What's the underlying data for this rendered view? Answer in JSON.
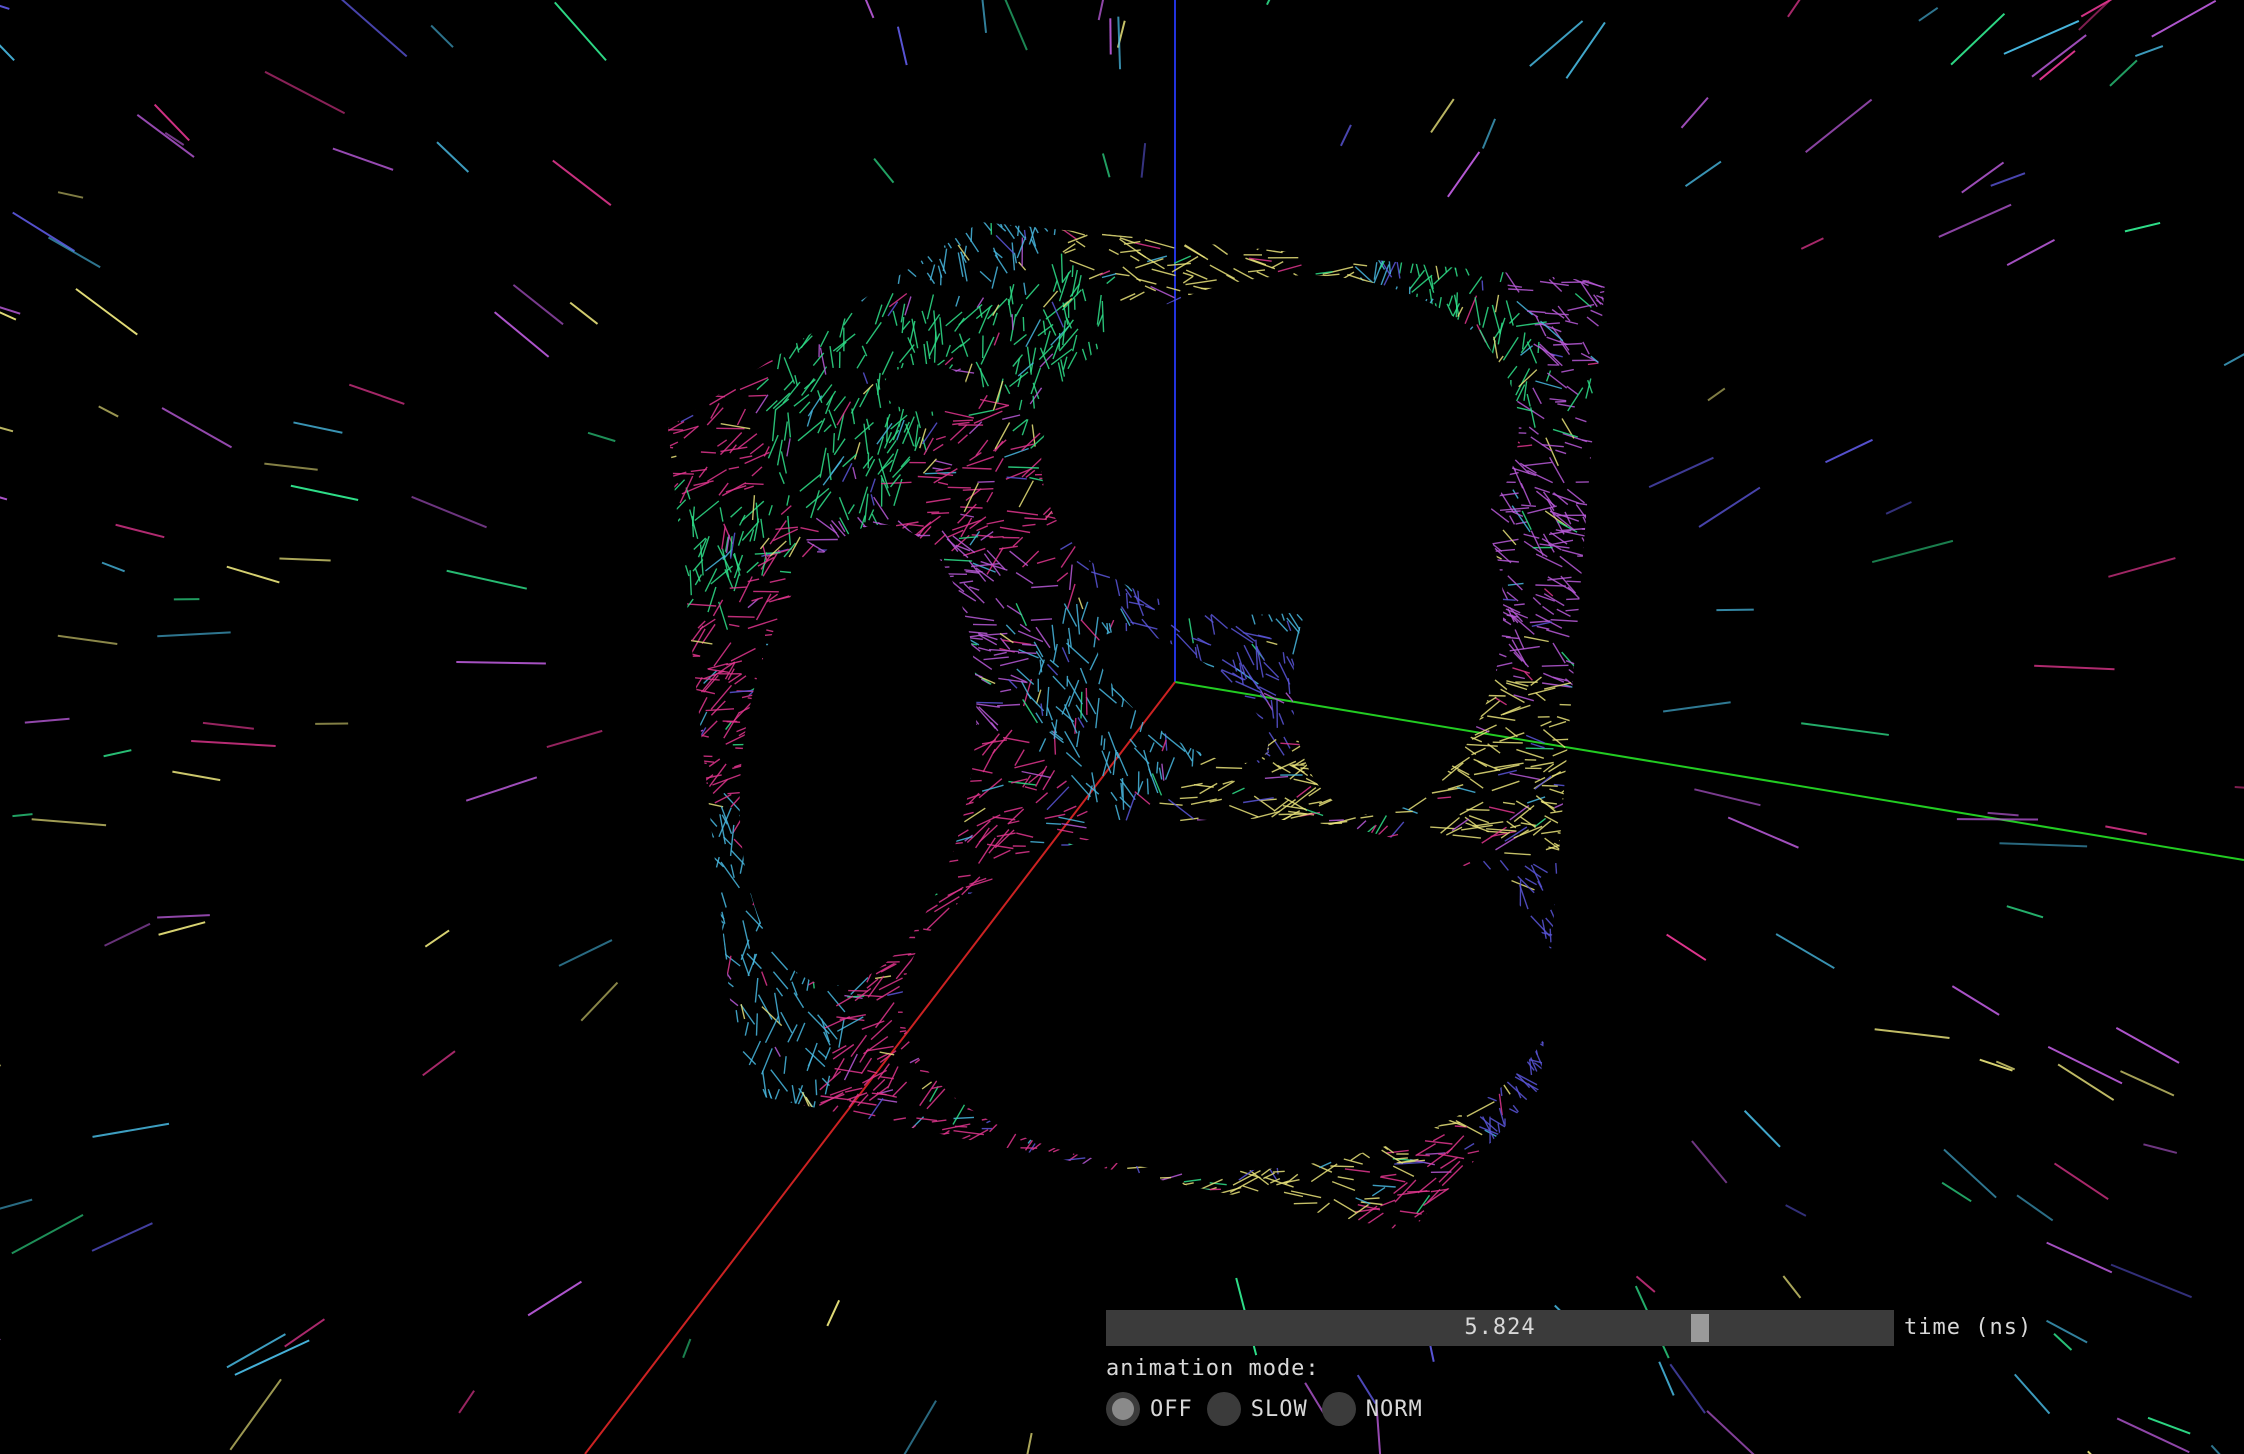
{
  "time_slider": {
    "value_text": "5.824",
    "position_fraction": 0.76,
    "label": "time (ns)"
  },
  "animation": {
    "label": "animation mode:",
    "modes": [
      {
        "label": "OFF",
        "selected": true
      },
      {
        "label": "SLOW",
        "selected": false
      },
      {
        "label": "NORM",
        "selected": false
      }
    ]
  },
  "colors": {
    "background": "#000000",
    "control_bg": "#3b3b3b",
    "axis_x": "#cc2222",
    "axis_y": "#22cc22",
    "axis_z": "#2233dd",
    "spins": [
      "#e8e27a",
      "#5a55d8",
      "#2fe08a",
      "#e0368e",
      "#b85ad8",
      "#48b8e0"
    ]
  }
}
